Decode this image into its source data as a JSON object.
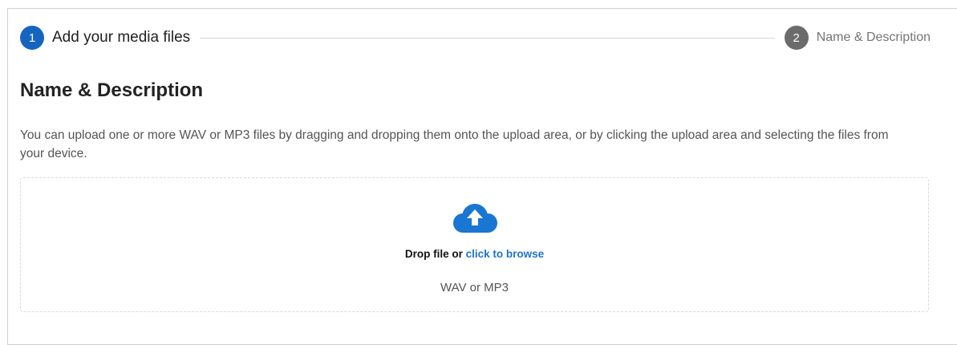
{
  "stepper": {
    "step1": {
      "number": "1",
      "label": "Add your media files",
      "state": "active"
    },
    "step2": {
      "number": "2",
      "label": "Name & Description",
      "state": "inactive"
    }
  },
  "section": {
    "title": "Name & Description",
    "description": "You can upload one or more WAV or MP3 files by dragging and dropping them onto the upload area, or by clicking the upload area and selecting the files from your device."
  },
  "dropzone": {
    "icon": "cloud-upload-icon",
    "prompt": "Drop file or",
    "link_text": "click to browse",
    "formats": "WAV or MP3"
  },
  "colors": {
    "accent": "#1565c0",
    "link": "#1e74c6",
    "inactive_step": "#6b6b6b",
    "icon": "#1976d2"
  }
}
